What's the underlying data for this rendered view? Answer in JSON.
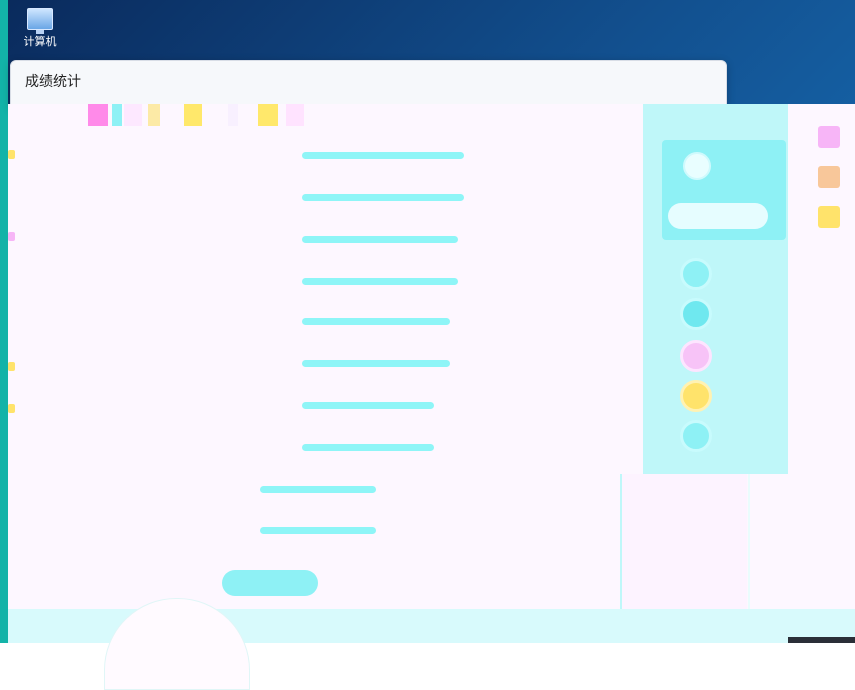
{
  "desktop": {
    "icon_label": "计算机",
    "icon_name": "computer-icon"
  },
  "window": {
    "title": "成绩统计"
  },
  "overlay": {
    "side": {
      "label_a": "",
      "label_b": "",
      "pill_label": ""
    },
    "bottom_button_label": ""
  },
  "colors": {
    "teal_edge": "#13b3a8",
    "overlay_bg": "#fdf7ff",
    "cyan_line": "#8ef5f7",
    "pink": "#f7b5f7",
    "yellow": "#ffe36b"
  }
}
